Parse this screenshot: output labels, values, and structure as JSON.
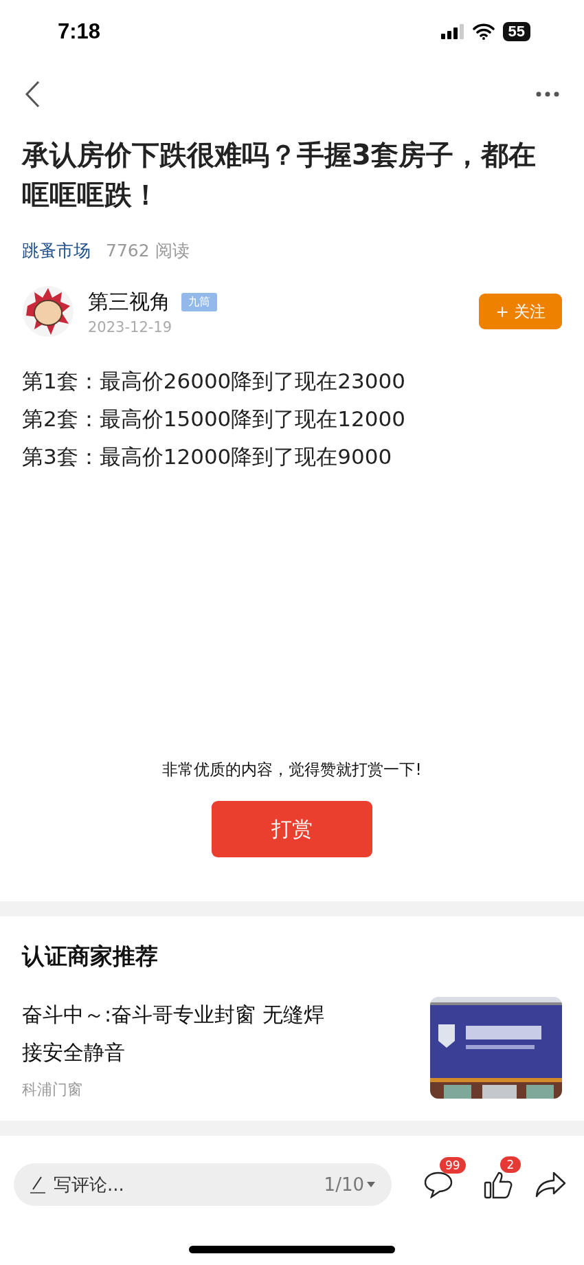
{
  "status_bar": {
    "time": "7:18",
    "battery": "55"
  },
  "article": {
    "title": "承认房价下跌很难吗？手握3套房子，都在哐哐哐跌！",
    "channel": "跳蚤市场",
    "reads": "7762 阅读",
    "author": {
      "name": "第三视角",
      "badge": "九筒",
      "date": "2023-12-19",
      "follow_button": "+ 关注",
      "followed": false
    },
    "paragraphs": [
      "第1套：最高价26000降到了现在23000",
      "第2套：最高价15000降到了现在12000",
      "第3套：最高价12000降到了现在9000"
    ]
  },
  "reward": {
    "prompt": "非常优质的内容，觉得赞就打赏一下!",
    "button": "打赏"
  },
  "merchants": {
    "heading": "认证商家推荐",
    "items": [
      {
        "title": "奋斗中～:奋斗哥专业封窗 无缝焊接安全静音",
        "source": "科浦门窗",
        "kind": "picture"
      }
    ]
  },
  "bottom_bar": {
    "comment_placeholder": "写评论...",
    "page": "1/10",
    "comment_count": "99",
    "like_count": "2"
  }
}
